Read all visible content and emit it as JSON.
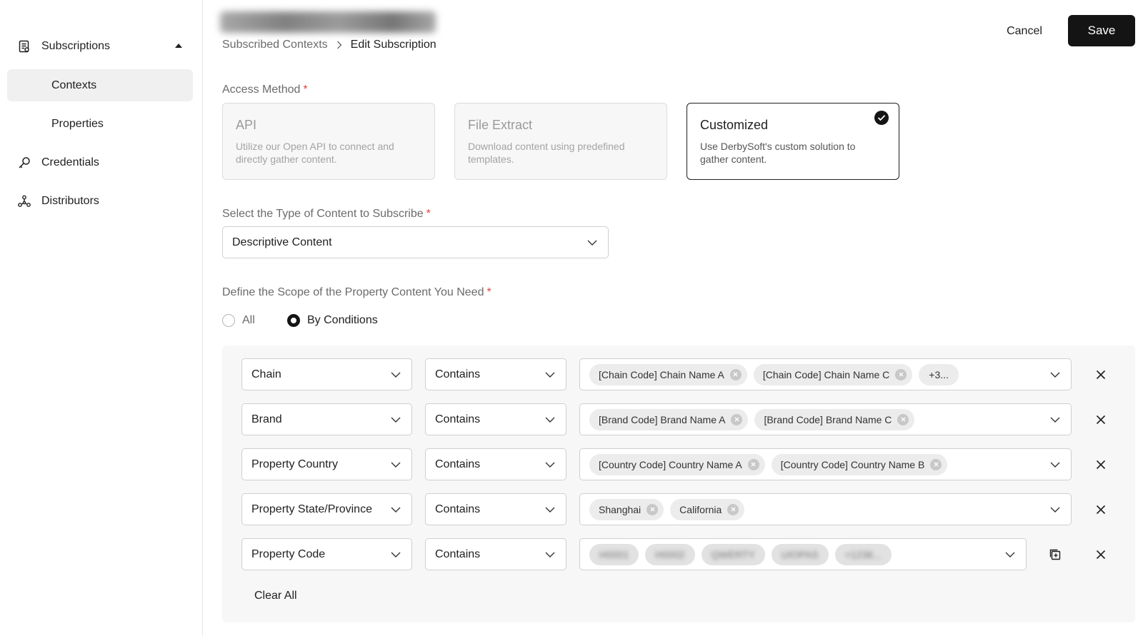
{
  "sidebar": {
    "subscriptions_label": "Subscriptions",
    "contexts_label": "Contexts",
    "properties_label": "Properties",
    "credentials_label": "Credentials",
    "distributors_label": "Distributors"
  },
  "header": {
    "breadcrumb_parent": "Subscribed Contexts",
    "breadcrumb_current": "Edit Subscription",
    "cancel_label": "Cancel",
    "save_label": "Save"
  },
  "access_method": {
    "label": "Access Method",
    "required": "*",
    "options": [
      {
        "title": "API",
        "desc": "Utilize our Open API to connect and directly gather content.",
        "selected": false
      },
      {
        "title": "File Extract",
        "desc": "Download content using predefined templates.",
        "selected": false
      },
      {
        "title": "Customized",
        "desc": "Use DerbySoft's custom solution to gather content.",
        "selected": true
      }
    ]
  },
  "content_type": {
    "label": "Select the Type of Content to Subscribe",
    "required": "*",
    "value": "Descriptive Content"
  },
  "scope": {
    "label": "Define the Scope of the Property Content You Need",
    "required": "*",
    "all_label": "All",
    "conditions_label": "By Conditions",
    "selected": "By Conditions"
  },
  "conditions": [
    {
      "field": "Chain",
      "operator": "Contains",
      "tags": [
        "[Chain Code] Chain Name A",
        "[Chain Code] Chain Name C"
      ],
      "more": "+3..."
    },
    {
      "field": "Brand",
      "operator": "Contains",
      "tags": [
        "[Brand Code] Brand Name A",
        "[Brand Code] Brand Name C"
      ]
    },
    {
      "field": "Property Country",
      "operator": "Contains",
      "tags": [
        "[Country Code] Country Name A",
        "[Country Code] Country Name B"
      ]
    },
    {
      "field": "Property State/Province",
      "operator": "Contains",
      "tags": [
        "Shanghai",
        "California"
      ]
    },
    {
      "field": "Property Code",
      "operator": "Contains",
      "blurred_tags": [
        "H0001",
        "H0002",
        "QWERTY",
        "UIOPAS",
        "+1236..."
      ]
    }
  ],
  "clear_all_label": "Clear All",
  "colors": {
    "primary": "#141414",
    "required": "#e0453a",
    "panel_bg": "#f7f7f7",
    "muted_text": "#6b6b6b"
  }
}
